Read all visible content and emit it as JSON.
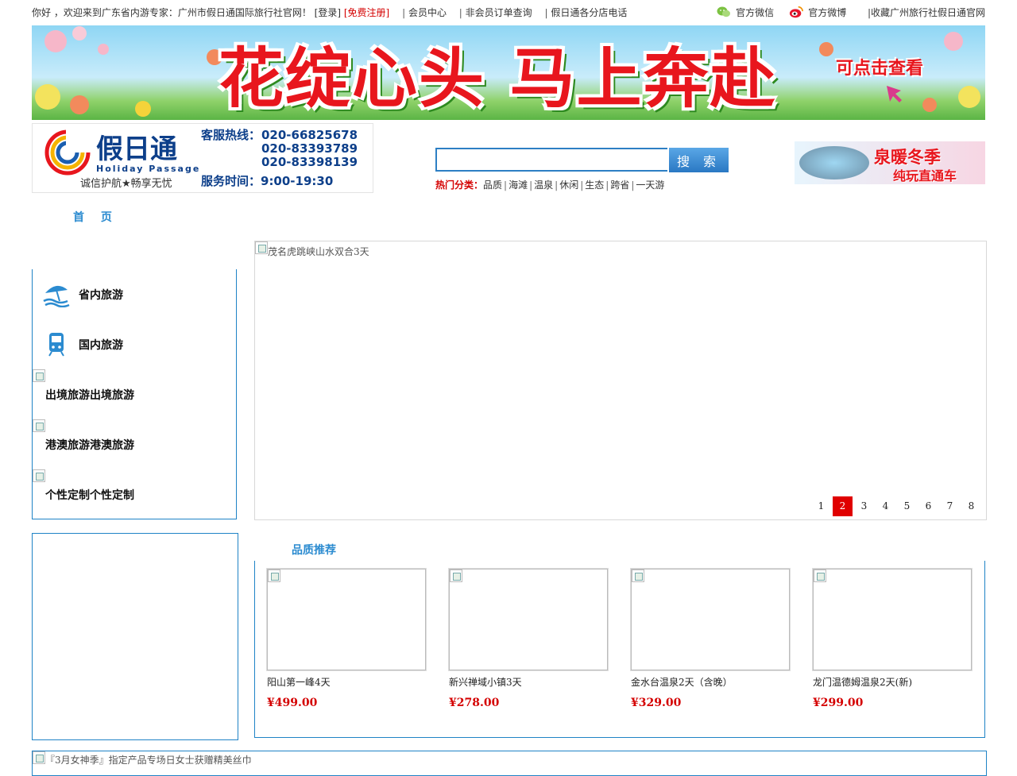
{
  "topbar": {
    "welcome": "你好 ，欢迎来到广东省内游专家：广州市假日通国际旅行社官网！",
    "login": "[登录]",
    "register": "[免费注册]",
    "member_center": "会员中心",
    "order_query": "非会员订单查询",
    "branch_phone": "假日通各分店电话",
    "wechat": "官方微信",
    "weibo": "官方微博",
    "favorite": "|收藏广州旅行社假日通官网",
    "separator": "|"
  },
  "banner": {
    "title": "花绽心头 马上奔赴",
    "hint": "可点击查看"
  },
  "logo": {
    "brand": "假日通",
    "brand_en": "Holiday  Passage",
    "slogan": "诚信护航★畅享无忧",
    "hotline_label": "客服热线：",
    "hotlines": [
      "020-66825678",
      "020-83393789",
      "020-83398139"
    ],
    "hours": "服务时间：9:00-19:30"
  },
  "search": {
    "placeholder": "",
    "button": "搜 索",
    "hot_label": "热门分类：",
    "categories": [
      "品质",
      "海滩",
      "温泉",
      "休闲",
      "生态",
      "跨省",
      "一天游"
    ]
  },
  "promo": {
    "line1": "泉暖冬季",
    "line2": "纯玩直通车"
  },
  "nav": {
    "home": "首 页"
  },
  "sidebar": {
    "items": [
      {
        "label": "省内旅游",
        "icon": "beach-umbrella-icon"
      },
      {
        "label": "国内旅游",
        "icon": "train-icon"
      },
      {
        "label": "出境旅游出境旅游",
        "icon": "broken-image-icon"
      },
      {
        "label": "港澳旅游港澳旅游",
        "icon": "broken-image-icon"
      },
      {
        "label": "个性定制个性定制",
        "icon": "broken-image-icon"
      }
    ]
  },
  "slider": {
    "alt": "茂名虎跳峡山水双合3天",
    "pages": [
      "1",
      "2",
      "3",
      "4",
      "5",
      "6",
      "7",
      "8"
    ],
    "active_page": "2"
  },
  "quality": {
    "title": "品质推荐",
    "products": [
      {
        "name": "阳山第一峰4天",
        "price": "¥499.00"
      },
      {
        "name": "新兴禅域小镇3天",
        "price": "¥278.00"
      },
      {
        "name": "金水台温泉2天（含晚）",
        "price": "¥329.00"
      },
      {
        "name": "龙门温德姆温泉2天(新)",
        "price": "¥299.00"
      }
    ]
  },
  "bottom": {
    "alt": "『3月女神季』指定产品专场日女士获赠精美丝巾"
  },
  "colors": {
    "accent_blue": "#1f83c6",
    "link_blue": "#2b8bd0",
    "price_red": "#d40000",
    "active_page_red": "#e00000"
  }
}
